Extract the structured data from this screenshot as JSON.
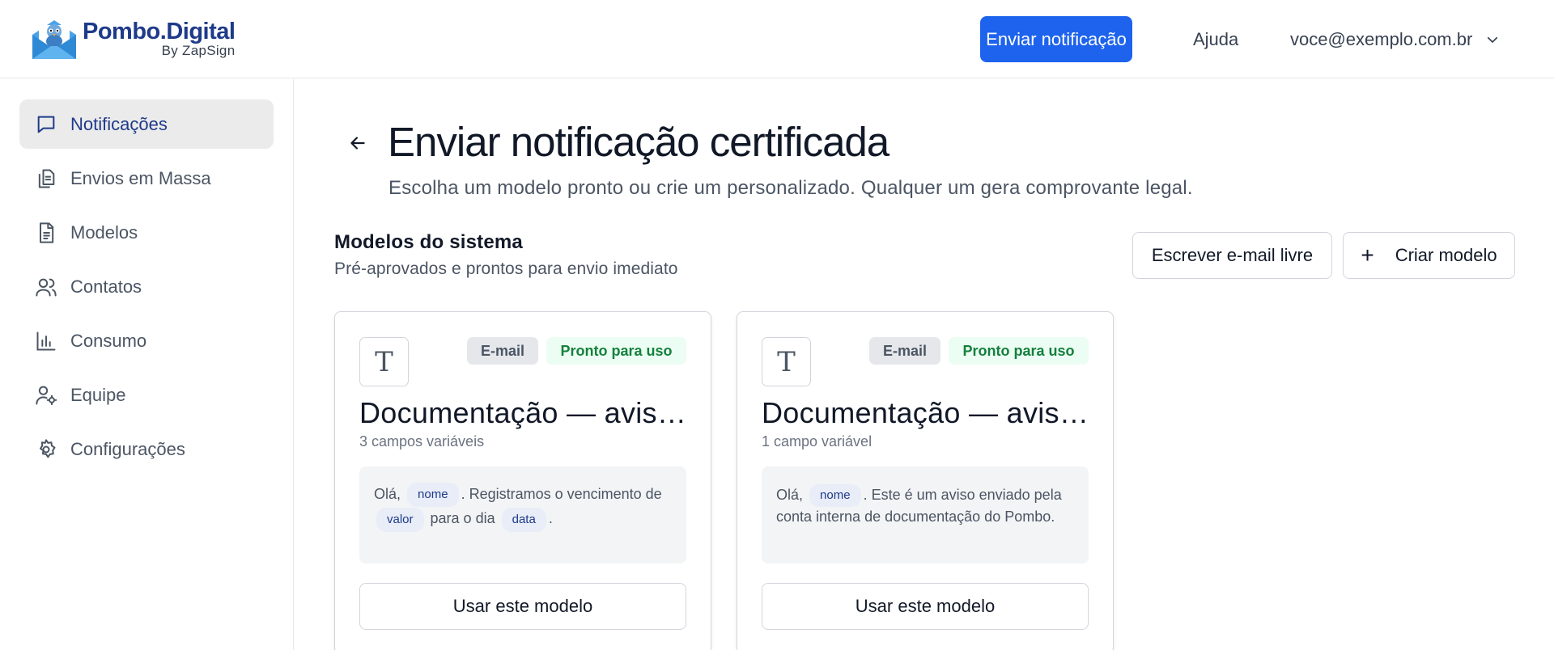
{
  "brand": {
    "name": "Pombo.Digital",
    "byline": "By ZapSign"
  },
  "header": {
    "primary_action": "Enviar notificação",
    "help": "Ajuda",
    "user_email": "voce@exemplo.com.br"
  },
  "sidebar": {
    "items": [
      {
        "label": "Notificações",
        "icon": "chat-bubble-icon",
        "active": true
      },
      {
        "label": "Envios em Massa",
        "icon": "copy-documents-icon",
        "active": false
      },
      {
        "label": "Modelos",
        "icon": "document-icon",
        "active": false
      },
      {
        "label": "Contatos",
        "icon": "users-icon",
        "active": false
      },
      {
        "label": "Consumo",
        "icon": "bar-chart-icon",
        "active": false
      },
      {
        "label": "Equipe",
        "icon": "user-settings-icon",
        "active": false
      },
      {
        "label": "Configurações",
        "icon": "gear-icon",
        "active": false
      }
    ]
  },
  "page": {
    "title": "Enviar notificação certificada",
    "subtitle": "Escolha um modelo pronto ou crie um personalizado. Qualquer um gera comprovante legal."
  },
  "section": {
    "title": "Modelos do sistema",
    "subtitle": "Pré-aprovados e prontos para envio imediato",
    "free_email_label": "Escrever e-mail livre",
    "create_plus": "+",
    "create_label": "Criar modelo"
  },
  "cards": [
    {
      "icon_glyph": "T",
      "type_badge": "E-mail",
      "status_badge": "Pronto para uso",
      "title": "Documentação — aviso de vencimento",
      "meta": "3 campos variáveis",
      "preview": {
        "t1": "Olá,",
        "v1": "nome",
        "t2": ". Registramos o vencimento de",
        "v2": "valor",
        "t3": "para o dia",
        "v3": "data",
        "t4": "."
      },
      "action": "Usar este modelo"
    },
    {
      "icon_glyph": "T",
      "type_badge": "E-mail",
      "status_badge": "Pronto para uso",
      "title": "Documentação — aviso interno",
      "meta": "1 campo variável",
      "preview": {
        "t1": "Olá,",
        "v1": "nome",
        "t2": ". Este é um aviso enviado pela conta interna de documentação do Pombo."
      },
      "action": "Usar este modelo"
    }
  ],
  "colors": {
    "primary": "#1d63ed",
    "brand_navy": "#1e3a8a",
    "ready_green": "#15803d",
    "ready_bg": "#ecfdf3"
  }
}
